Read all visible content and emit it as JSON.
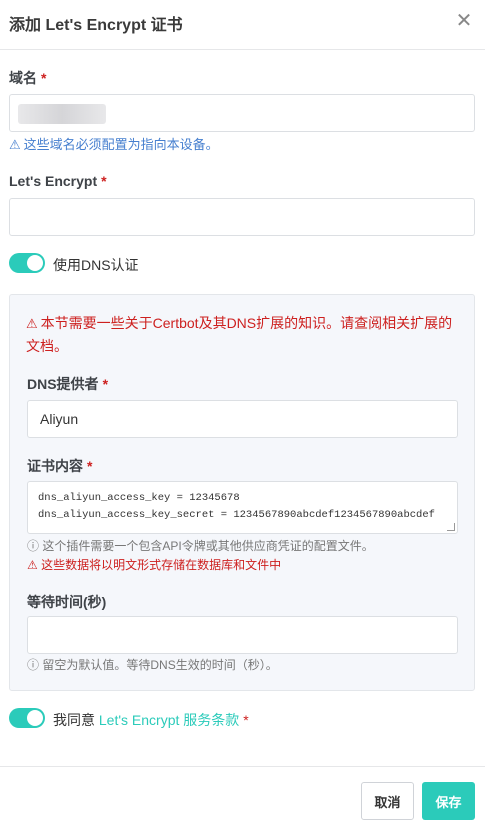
{
  "dialog": {
    "title": "添加 Let's Encrypt 证书",
    "close_glyph": "✕"
  },
  "domain": {
    "label": "域名",
    "required": "*",
    "hint": "这些域名必须配置为指向本设备。"
  },
  "email": {
    "label": "Let's Encrypt",
    "required": "*",
    "value": ""
  },
  "dns_toggle": {
    "label": "使用DNS认证",
    "on": true
  },
  "dns_section": {
    "warning": "本节需要一些关于Certbot及其DNS扩展的知识。请查阅相关扩展的文档。",
    "provider_label": "DNS提供者",
    "provider_value": "Aliyun",
    "credentials_label": "证书内容",
    "credentials_lines": [
      "dns_aliyun_access_key = 12345678",
      "dns_aliyun_access_key_secret = 1234567890abcdef1234567890abcdef"
    ],
    "credentials_info": "这个插件需要一个包含API令牌或其他供应商凭证的配置文件。",
    "credentials_warning": "这些数据将以明文形式存储在数据库和文件中",
    "wait_label": "等待时间(秒)",
    "wait_value": "",
    "wait_info": "留空为默认值。等待DNS生效的时间（秒）。"
  },
  "agree": {
    "prefix": "我同意 ",
    "link": "Let's Encrypt 服务条款",
    "required": "*",
    "on": true
  },
  "buttons": {
    "cancel": "取消",
    "save": "保存"
  },
  "colors": {
    "accent": "#2bcbba",
    "danger": "#cd201f",
    "info": "#467fcf"
  },
  "glyphs": {
    "warning": "⚠",
    "info": "ⓘ"
  }
}
